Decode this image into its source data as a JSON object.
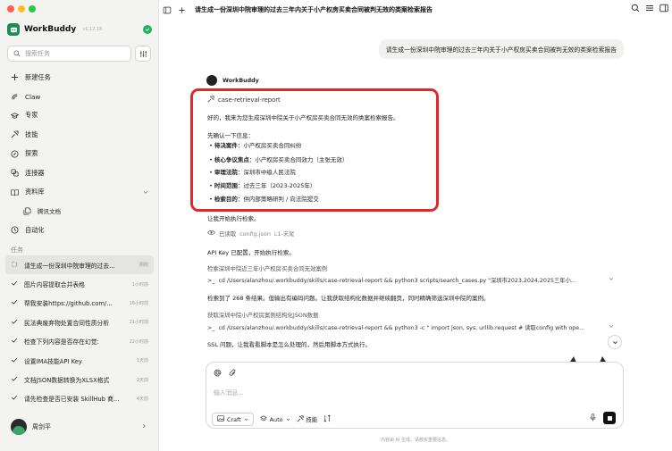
{
  "app": {
    "name": "WorkBuddy",
    "version": "v1.12.18"
  },
  "search": {
    "placeholder": "搜索任务"
  },
  "nav": [
    {
      "label": "新建任务",
      "icon": "plus-icon"
    },
    {
      "label": "Claw",
      "icon": "claw-icon"
    },
    {
      "label": "专家",
      "icon": "graduation-cap-icon"
    },
    {
      "label": "技能",
      "icon": "skill-icon"
    },
    {
      "label": "探索",
      "icon": "compass-icon"
    },
    {
      "label": "连接器",
      "icon": "connector-icon"
    },
    {
      "label": "资料库",
      "icon": "book-icon"
    },
    {
      "label": "腾讯文档",
      "icon": "document-icon"
    },
    {
      "label": "自动化",
      "icon": "clock-icon"
    }
  ],
  "tasks_heading": "任务",
  "tasks": [
    {
      "title": "请生成一份深圳中院审理的过去...",
      "time": "刚刚",
      "active": true
    },
    {
      "title": "图片内容提取合并表格",
      "time": "1小时前"
    },
    {
      "title": "帮我安装https://github.com/...",
      "time": "16小时前"
    },
    {
      "title": "民法典废弃物处置合同性质分析",
      "time": "21小时前"
    },
    {
      "title": "检查下列内容是否存在幻觉:",
      "time": "22小时前"
    },
    {
      "title": "设置IMA技能API Key",
      "time": "1天前"
    },
    {
      "title": "文档JSON数据转换为XLSX格式",
      "time": "2天前"
    },
    {
      "title": "请先检查是否已安装 SkillHub 商...",
      "time": "4天前"
    }
  ],
  "user": {
    "name": "周剑平"
  },
  "header": {
    "title": "请生成一份深圳中院审理的过去三年内关于小产权房买卖合同被判无效的类案检索报告"
  },
  "chat": {
    "user_message": "请生成一份深圳中院审理的过去三年内关于小产权房买卖合同被判无效的类案检索报告",
    "bot_name": "WorkBuddy",
    "skill": "case-retrieval-report",
    "intro": "好的，我来为您生成深圳中院关于小产权房买卖合同无效的类案检索报告。",
    "confirm_heading": "先确认一下信息：",
    "bullets": [
      {
        "label": "待决案件",
        "value": "：小产权房买卖合同纠纷"
      },
      {
        "label": "核心争议焦点",
        "value": "：小产权房买卖合同效力（主张无效）"
      },
      {
        "label": "审理法院",
        "value": "：深圳市中级人民法院"
      },
      {
        "label": "时间范围",
        "value": "：过去三年（2023-2025年）"
      },
      {
        "label": "检索目的",
        "value": "：供内部策略研判 / 向法院提交"
      }
    ],
    "start": "让我开始执行检索。",
    "read_label": "已读取",
    "read_path": "config.json",
    "read_range": "L1-末尾",
    "api_msg": "API Key 已配置，开始执行检索。",
    "step1_title": "检索深圳中院近三年小产权房买卖合同无效案例",
    "step1_cmd": "cd /Users/alanzhou/.workbuddy/skills/case-retrieval-report && python3 scripts/search_cases.py \"深圳市2023,2024,2025三年小...",
    "step1_result": "检索到了 268 条结果。但输出有编码问题。让我获取结构化数据并继续翻页，同时精确筛选深圳中院的案例。",
    "step2_title": "获取深圳中院小产权房案例结构化JSON数据",
    "step2_cmd": "cd /Users/alanzhou/.workbuddy/skills/case-retrieval-report && python3 -c \" import json, sys, urllib.request # 读取config with ope...",
    "ssl_msg": "SSL 问题，让我看看脚本是怎么处理的，然后用脚本方式执行。"
  },
  "composer": {
    "placeholder": "输入消息...",
    "mode": "Craft",
    "model": "Auto",
    "skill_label": "技能"
  },
  "footer_note": "内容由 AI 生成，请核实重要信息。",
  "colors": {
    "accent": "#1c8b5a",
    "status": "#22b35e",
    "highlight": "#e22828"
  }
}
